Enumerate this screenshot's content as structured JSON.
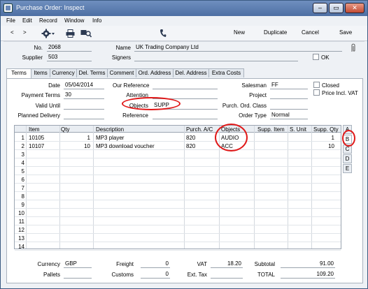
{
  "window": {
    "title": "Purchase Order: Inspect",
    "controls": {
      "minimize": "–",
      "maximize": "▭",
      "close": "✕"
    }
  },
  "menu": [
    "File",
    "Edit",
    "Record",
    "Window",
    "Info"
  ],
  "toolbar": {
    "back": "<",
    "forward": ">",
    "new": "New",
    "duplicate": "Duplicate",
    "cancel": "Cancel",
    "save": "Save"
  },
  "header": {
    "no_label": "No.",
    "no_value": "2068",
    "name_label": "Name",
    "name_value": "UK Trading Company Ltd",
    "supplier_label": "Supplier",
    "supplier_value": "503",
    "signers_label": "Signers",
    "signers_value": "",
    "ok_label": "OK"
  },
  "tabs": [
    "Terms",
    "Items",
    "Currency",
    "Del. Terms",
    "Comment",
    "Ord. Address",
    "Del. Address",
    "Extra Costs"
  ],
  "terms": {
    "date_label": "Date",
    "date_value": "05/04/2014",
    "our_ref_label": "Our Reference",
    "our_ref_value": "",
    "salesman_label": "Salesman",
    "salesman_value": "FF",
    "closed_label": "Closed",
    "payment_terms_label": "Payment Terms",
    "payment_terms_value": "30",
    "attention_label": "Attention",
    "attention_value": "",
    "project_label": "Project",
    "project_value": "",
    "price_incl_vat_label": "Price Incl. VAT",
    "valid_until_label": "Valid Until",
    "valid_until_value": "",
    "objects_label": "Objects",
    "objects_value": "SUPP",
    "purch_ord_class_label": "Purch. Ord. Class",
    "purch_ord_class_value": "",
    "planned_delivery_label": "Planned Delivery",
    "planned_delivery_value": "",
    "reference_label": "Reference",
    "reference_value": "",
    "order_type_label": "Order Type",
    "order_type_value": "Normal"
  },
  "grid": {
    "headers": [
      "Item",
      "Qty",
      "Description",
      "Purch. A/C",
      "Objects",
      "Supp. Item",
      "S. Unit",
      "Supp. Qty"
    ],
    "rows": [
      {
        "n": "1",
        "item": "10105",
        "qty": "1",
        "desc": "MP3 player",
        "ac": "820",
        "obj": "AUDIO",
        "si": "",
        "su": "",
        "sq": "1"
      },
      {
        "n": "2",
        "item": "10107",
        "qty": "10",
        "desc": "MP3 download voucher",
        "ac": "820",
        "obj": "ACC",
        "si": "",
        "su": "",
        "sq": "10"
      },
      {
        "n": "3"
      },
      {
        "n": "4"
      },
      {
        "n": "5"
      },
      {
        "n": "6"
      },
      {
        "n": "7"
      },
      {
        "n": "8"
      },
      {
        "n": "9"
      },
      {
        "n": "10"
      },
      {
        "n": "11"
      },
      {
        "n": "12"
      },
      {
        "n": "13"
      },
      {
        "n": "14"
      }
    ],
    "side_tabs": [
      "A",
      "B",
      "C",
      "D",
      "E"
    ]
  },
  "footer": {
    "currency_label": "Currency",
    "currency_value": "GBP",
    "freight_label": "Freight",
    "freight_value": "0",
    "vat_label": "VAT",
    "vat_value": "18.20",
    "subtotal_label": "Subtotal",
    "subtotal_value": "91.00",
    "pallets_label": "Pallets",
    "pallets_value": "",
    "customs_label": "Customs",
    "customs_value": "0",
    "ext_tax_label": "Ext. Tax",
    "ext_tax_value": "",
    "total_label": "TOTAL",
    "total_value": "109.20"
  },
  "icons": {
    "gear": "gear-icon",
    "print": "printer-icon",
    "preview": "print-preview-icon",
    "phone": "phone-icon",
    "attach": "paperclip-icon"
  },
  "colors": {
    "annotation": "#e01818",
    "titlebar": "#4d6fa3"
  }
}
